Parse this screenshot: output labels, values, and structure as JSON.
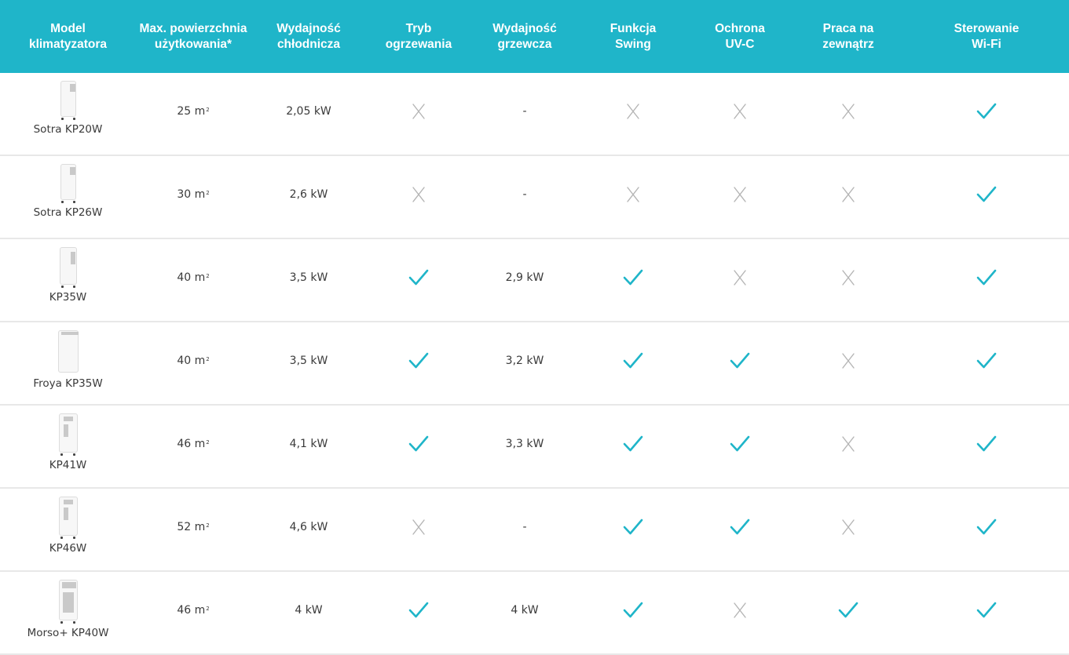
{
  "header": {
    "columns": [
      [
        "Model",
        "klimatyzatora"
      ],
      [
        "Max. powierzchnia",
        "użytkowania*"
      ],
      [
        "Wydajność",
        "chłodnicza"
      ],
      [
        "Tryb",
        "ogrzewania"
      ],
      [
        "Wydajność",
        "grzewcza"
      ],
      [
        "Funkcja",
        "Swing"
      ],
      [
        "Ochrona",
        "UV-C"
      ],
      [
        "Praca na",
        "zewnątrz"
      ],
      [
        "Sterowanie",
        "Wi-Fi"
      ]
    ]
  },
  "rows": [
    {
      "model": "Sotra KP20W",
      "area": "25 m",
      "area_sup": "2",
      "cooling": "2,05 kW",
      "heating_mode": "no",
      "heating": "-",
      "swing": "no",
      "uvc": "no",
      "outdoor": "no",
      "wifi": "yes",
      "image": "sotra-unit"
    },
    {
      "model": "Sotra KP26W",
      "area": "30 m",
      "area_sup": "2",
      "cooling": "2,6 kW",
      "heating_mode": "no",
      "heating": "-",
      "swing": "no",
      "uvc": "no",
      "outdoor": "no",
      "wifi": "yes",
      "image": "sotra-unit"
    },
    {
      "model": "KP35W",
      "area": "40 m",
      "area_sup": "2",
      "cooling": "3,5 kW",
      "heating_mode": "yes",
      "heating": "2,9 kW",
      "swing": "yes",
      "uvc": "no",
      "outdoor": "no",
      "wifi": "yes",
      "image": "kp35-unit"
    },
    {
      "model": "Froya KP35W",
      "area": "40 m",
      "area_sup": "2",
      "cooling": "3,5 kW",
      "heating_mode": "yes",
      "heating": "3,2 kW",
      "swing": "yes",
      "uvc": "yes",
      "outdoor": "no",
      "wifi": "yes",
      "image": "froya-unit"
    },
    {
      "model": "KP41W",
      "area": "46 m",
      "area_sup": "2",
      "cooling": "4,1 kW",
      "heating_mode": "yes",
      "heating": "3,3 kW",
      "swing": "yes",
      "uvc": "yes",
      "outdoor": "no",
      "wifi": "yes",
      "image": "kp41-unit"
    },
    {
      "model": "KP46W",
      "area": "52 m",
      "area_sup": "2",
      "cooling": "4,6 kW",
      "heating_mode": "no",
      "heating": "-",
      "swing": "yes",
      "uvc": "yes",
      "outdoor": "no",
      "wifi": "yes",
      "image": "kp41-unit"
    },
    {
      "model": "Morso+ KP40W",
      "area": "46 m",
      "area_sup": "2",
      "cooling": "4 kW",
      "heating_mode": "yes",
      "heating": "4 kW",
      "swing": "yes",
      "uvc": "no",
      "outdoor": "yes",
      "wifi": "yes",
      "image": "morso-unit"
    }
  ],
  "colors": {
    "header_bg": "#1fb5c9",
    "check": "#1fb5c9",
    "cross": "#b5b5b5",
    "divider": "#e8e8e8"
  },
  "icons": {
    "yes": "check-icon",
    "no": "cross-icon"
  }
}
